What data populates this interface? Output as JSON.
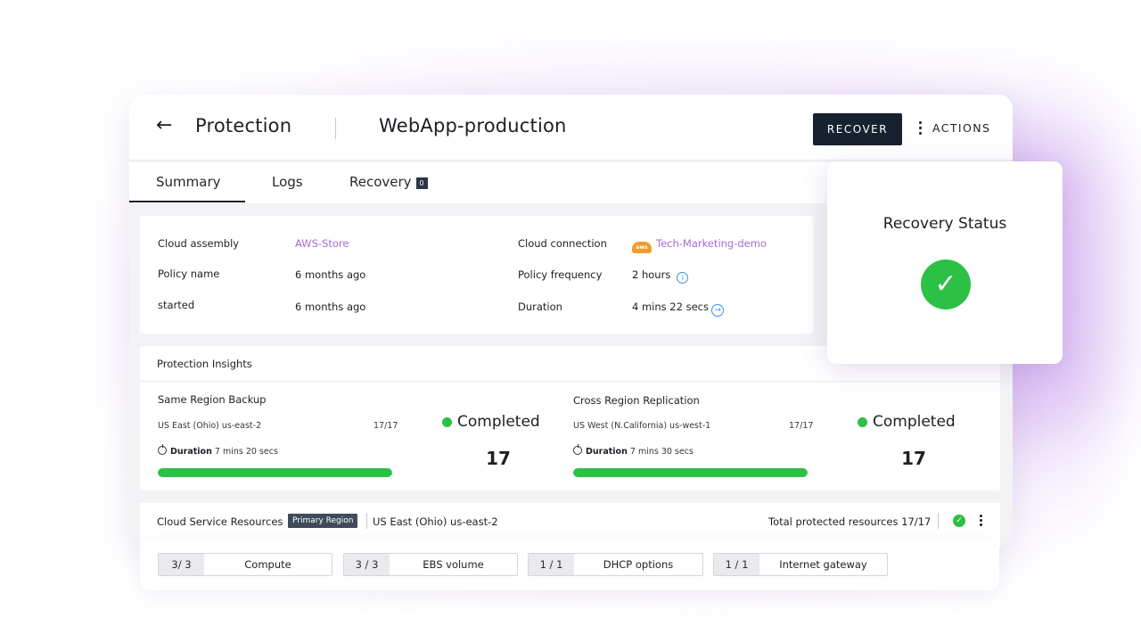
{
  "header": {
    "title": "Protection",
    "subtitle": "WebApp-production",
    "recover_label": "RECOVER",
    "actions_label": "ACTIONS"
  },
  "tabs": [
    {
      "label": "Summary",
      "active": true
    },
    {
      "label": "Logs"
    },
    {
      "label": "Recovery",
      "badge": "0"
    }
  ],
  "details": {
    "cloud_assembly_label": "Cloud assembly",
    "cloud_assembly_value": "AWS-Store",
    "policy_name_label": "Policy name",
    "policy_name_value": "6 months ago",
    "started_label": "started",
    "started_value": "6 months ago",
    "cloud_connection_label": "Cloud connection",
    "cloud_connection_value": "Tech-Marketing-demo",
    "cloud_connection_icon": "aws",
    "policy_frequency_label": "Policy frequency",
    "policy_frequency_value": "2 hours",
    "duration_label": "Duration",
    "duration_value": "4 mins 22 secs"
  },
  "insights": {
    "title": "Protection Insights",
    "same_region": {
      "title": "Same Region Backup",
      "region": "US East (Ohio) us-east-2",
      "fraction": "17/17",
      "duration_label": "Duration",
      "duration_value": "7 mins 20 secs",
      "progress": 1.0,
      "status": "Completed",
      "count": "17"
    },
    "cross_region": {
      "title": "Cross Region Replication",
      "region": "US West (N.California) us-west-1",
      "fraction": "17/17",
      "duration_label": "Duration",
      "duration_value": "7 mins 30 secs",
      "progress": 1.0,
      "status": "Completed",
      "count": "17"
    }
  },
  "resources": {
    "title": "Cloud Service Resources",
    "badge": "Primary Region",
    "region": "US East (Ohio) us-east-2",
    "total": "Total protected resources 17/17",
    "chips": [
      {
        "count": "3/ 3",
        "label": "Compute"
      },
      {
        "count": "3 / 3",
        "label": "EBS volume"
      },
      {
        "count": "1 / 1",
        "label": "DHCP options"
      },
      {
        "count": "1 / 1",
        "label": "Internet gateway"
      }
    ]
  },
  "recovery_status": {
    "title": "Recovery Status"
  },
  "colors": {
    "success": "#2cc045",
    "link": "#a76ad6",
    "primary_button": "#17212f"
  }
}
